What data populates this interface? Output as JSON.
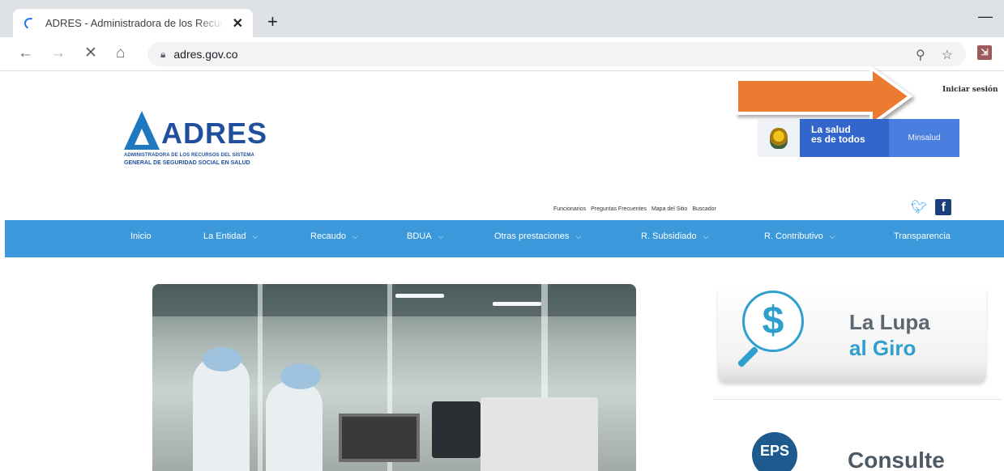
{
  "browser": {
    "tab_title": "ADRES - Administradora de los Recursos",
    "tab_close": "✕",
    "new_tab": "+",
    "url": "adres.gov.co"
  },
  "header": {
    "login": "Iniciar sesión",
    "logo_word": "ADRES",
    "logo_sub1": "ADMINISTRADORA DE LOS RECURSOS DEL SISTEMA",
    "logo_sub2": "GENERAL DE SEGURIDAD SOCIAL EN SALUD",
    "gov_salud_1": "La salud",
    "gov_salud_2": "es de todos",
    "gov_min": "Minsalud",
    "top_links": [
      "Funcionarios",
      "Preguntas Frecuentes",
      "Mapa del Sitio",
      "Buscador"
    ]
  },
  "nav": {
    "items": [
      {
        "label": "Inicio"
      },
      {
        "label": "La Entidad"
      },
      {
        "label": "Recaudo"
      },
      {
        "label": "BDUA"
      },
      {
        "label": "Otras prestaciones"
      },
      {
        "label": "R. Subsidiado"
      },
      {
        "label": "R. Contributivo"
      },
      {
        "label": "Transparencia"
      }
    ]
  },
  "sidebar": {
    "lupa_line1": "La Lupa",
    "lupa_line2": "al Giro",
    "lupa_symbol": "$",
    "eps_label": "EPS",
    "consulte": "Consulte"
  },
  "colors": {
    "nav_blue": "#3a98db",
    "brand_blue": "#1f4f9d",
    "accent_arrow": "#ec7a30",
    "lupa_blue": "#2f9fd0"
  },
  "icons": [
    "back-icon",
    "forward-icon",
    "stop-icon",
    "home-icon",
    "lock-icon",
    "zoom-icon",
    "star-icon",
    "twitter-icon",
    "facebook-icon",
    "arrow-annotation-icon"
  ]
}
